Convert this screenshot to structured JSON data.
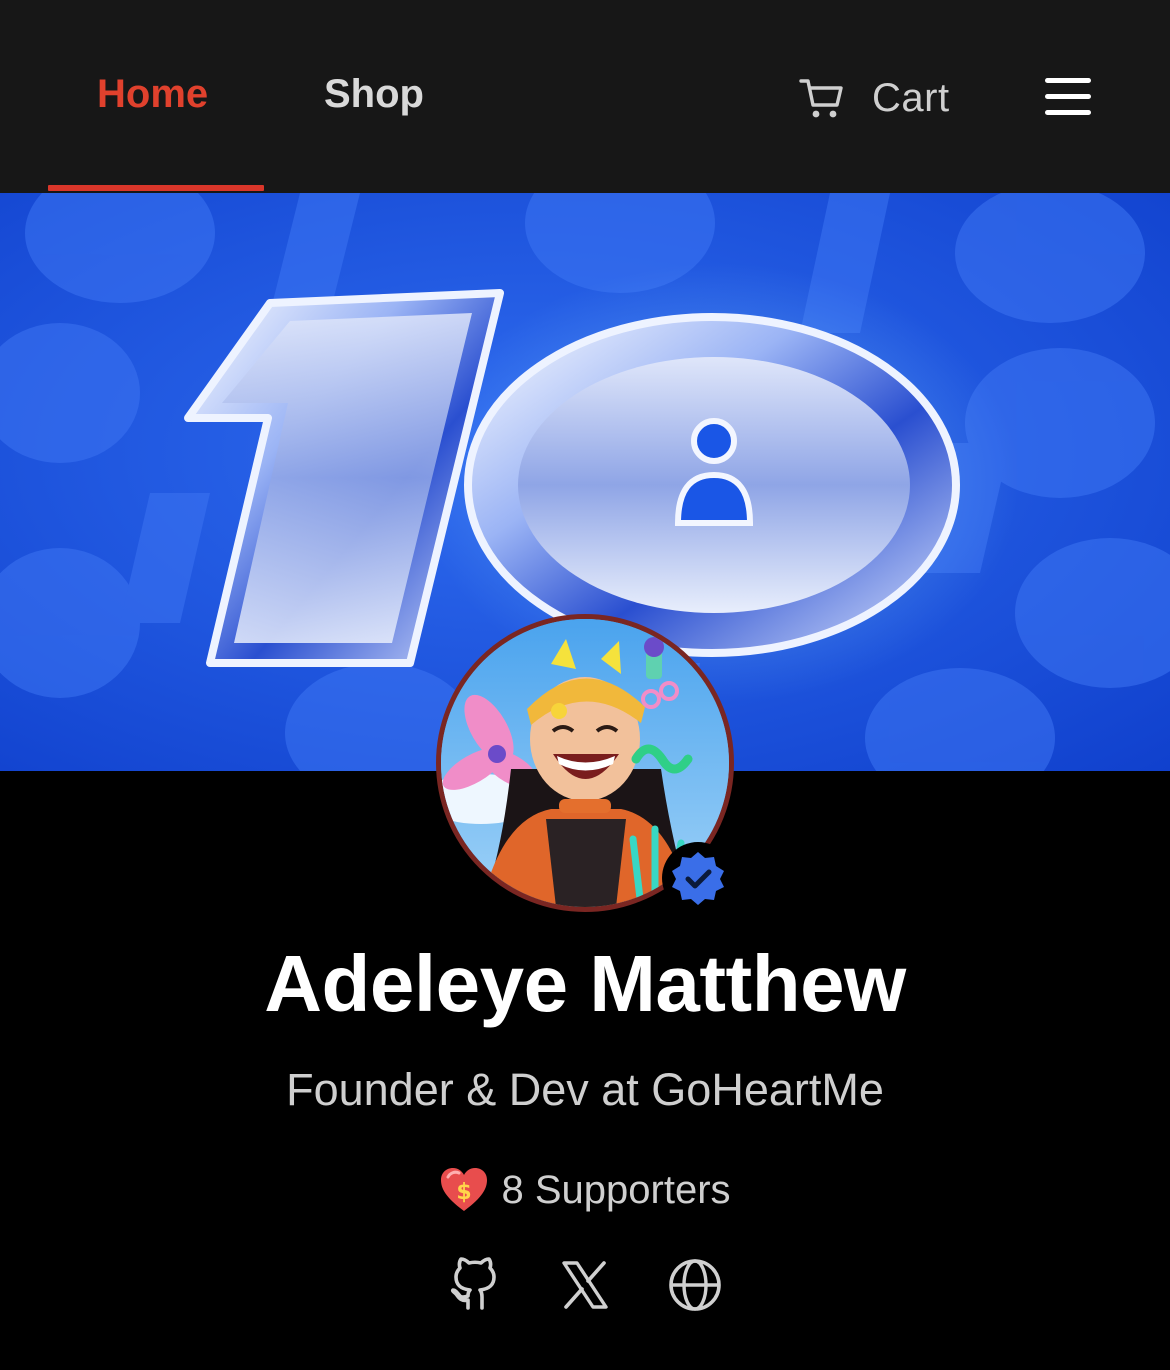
{
  "nav": {
    "tabs": [
      {
        "label": "Home",
        "active": true
      },
      {
        "label": "Shop",
        "active": false
      }
    ],
    "cart_label": "Cart",
    "cart_icon": "cart-icon",
    "menu_icon": "hamburger-menu-icon",
    "accent_color": "#e0412d"
  },
  "banner": {
    "badge_text": "10",
    "background_color": "#1553e0"
  },
  "profile": {
    "name": "Adeleye Matthew",
    "tagline": "Founder & Dev at GoHeartMe",
    "verified": true,
    "verified_color": "#3a6ee8",
    "supporters_label": "8 Supporters",
    "supporters_icon": "heart-dollar-icon",
    "socials": [
      {
        "icon": "github-icon"
      },
      {
        "icon": "x-icon"
      },
      {
        "icon": "globe-icon"
      }
    ]
  }
}
